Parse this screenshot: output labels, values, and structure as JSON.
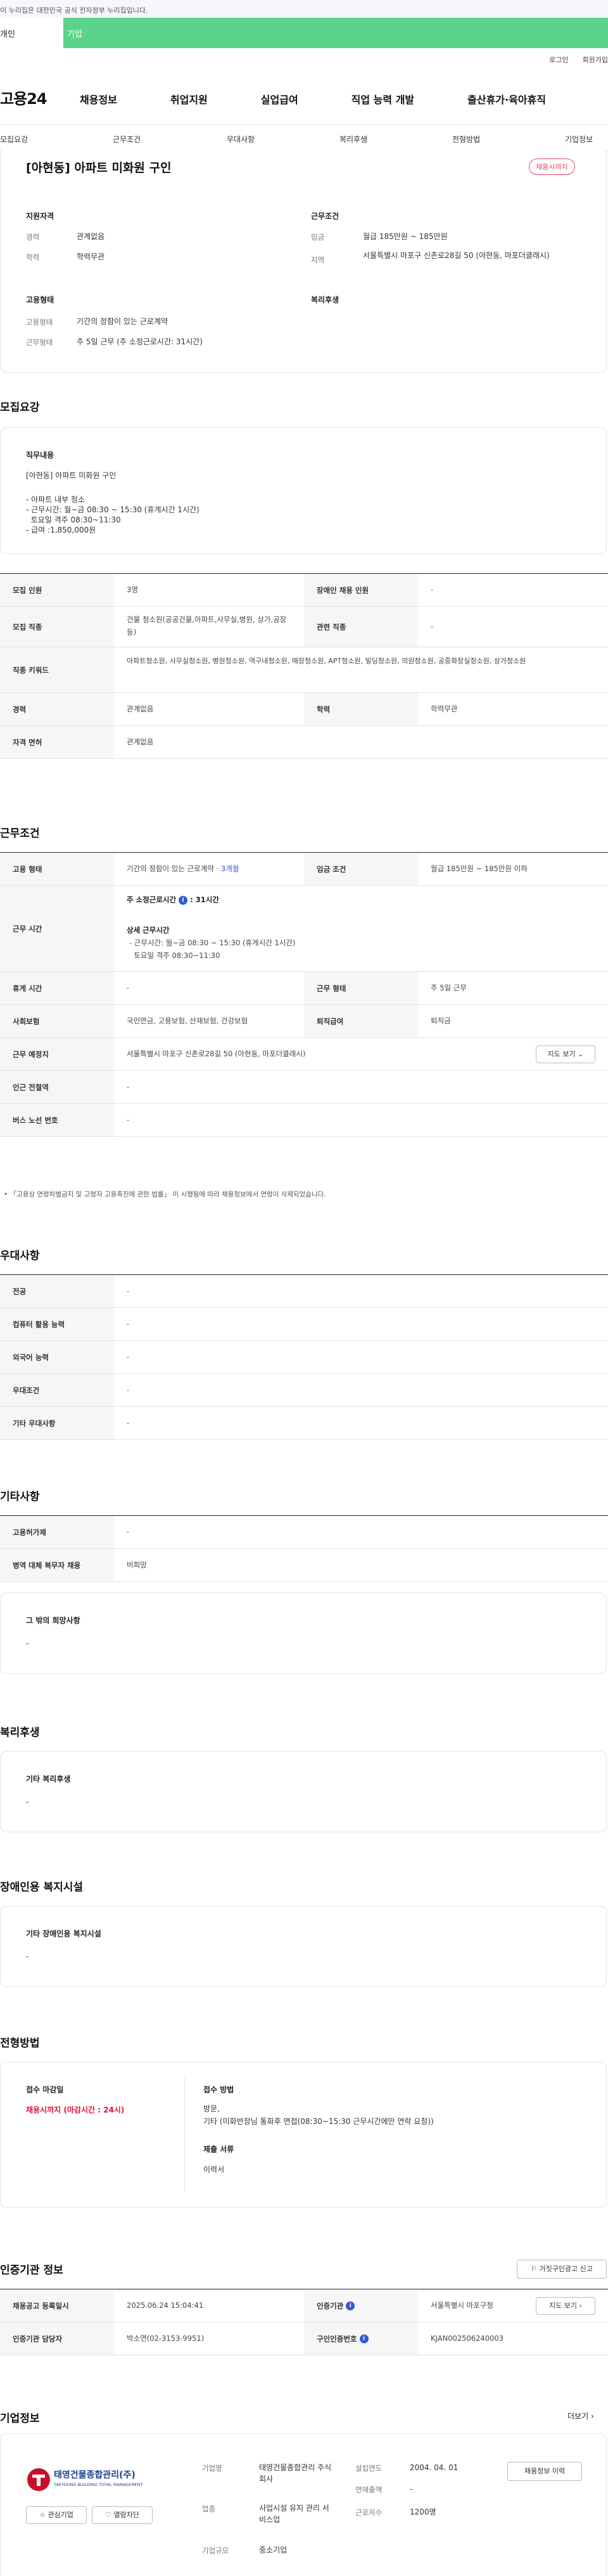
{
  "gov_banner": "이 누리집은 대한민국 공식 전자정부 누리집입니다.",
  "tabs": [
    "개인",
    "기업"
  ],
  "top_links": [
    "로그인",
    "회원가입"
  ],
  "logo": "고용24",
  "gnb": [
    "채용정보",
    "취업지원",
    "실업급여",
    "직업 능력 개발",
    "출산휴가·육아휴직"
  ],
  "subnav": [
    "모집요강",
    "근무조건",
    "우대사항",
    "복리후생",
    "전형방법",
    "기업정보"
  ],
  "summary": {
    "title": "[아현동] 아파트 미화원 구인",
    "badge": "채용시까지",
    "qual_title": "지원자격",
    "career_k": "경력",
    "career_v": "관계없음",
    "edu_k": "학력",
    "edu_v": "학력무관",
    "cond_title": "근무조건",
    "wage_k": "임금",
    "wage_v": "월급 185만원 ~ 185만원",
    "area_k": "지역",
    "area_v": "서울특별시 마포구 신촌로28길 50 (아현동, 마포더클래시)",
    "emp_title": "고용형태",
    "type_k": "고용형태",
    "type_v": "기간의 정함이 있는 근로계약",
    "hours_k": "근무형태",
    "hours_v": "주 5일 근무 (주 소정근로시간: 31시간)",
    "welfare_title": "복리후생"
  },
  "recruit": {
    "section": "모집요강",
    "duty_title": "직무내용",
    "duty_lines": [
      "[아현동] 아파트 미화원 구인",
      "",
      "- 아파트 내부 청소",
      "- 근무시간: 월~금 08:30 ~  15:30 (휴게시간 1시간)",
      "  토요일 격주 08:30~11:30",
      "- 급여 :1,850,000원"
    ],
    "rows": [
      {
        "k1": "모집 인원",
        "v1": "3명",
        "k2": "장애인 채용 인원",
        "v2": "-"
      },
      {
        "k1": "모집 직종",
        "v1": "건물 청소원(공공건물,아파트,사무실,병원, 상가,공장 등)",
        "k2": "관련 직종",
        "v2": "-"
      },
      {
        "k1": "직종 키워드",
        "v1": "아파트청소원, 사무실청소원, 병원청소원, 역구내청소원, 매장청소원, APT청소원, 빌딩청소원, 의원청소원, 공중화장실청소원, 상가청소원"
      },
      {
        "k1": "경력",
        "v1": "관계없음",
        "k2": "학력",
        "v2": "학력무관"
      },
      {
        "k1": "자격 면허",
        "v1": "관계없음"
      }
    ]
  },
  "conditions": {
    "section": "근무조건",
    "emp_k": "고용 형태",
    "emp_v": "기간의 정함이 있는 근로계약 · ",
    "emp_months": "3개월",
    "wage_k": "임금 조건",
    "wage_v": "월급 185만원 ~ 185만원 이하",
    "hours_k": "근무 시간",
    "weekly_label": "주 소정근로시간",
    "weekly_v": "31시간",
    "detail_label": "상세 근무시간",
    "detail_lines": [
      "- 근무시간: 월~금 08:30 ~  15:30 (휴게시간 1시간)",
      "  토요일 격주 08:30~11:30"
    ],
    "rest_k": "휴게 시간",
    "rest_v": "-",
    "form_k": "근무 형태",
    "form_v": "주 5일 근무",
    "ins_k": "사회보험",
    "ins_v": "국민연금, 고용보험, 산재보험, 건강보험",
    "ret_k": "퇴직급여",
    "ret_v": "퇴직금",
    "place_k": "근무 예정지",
    "place_v": "서울특별시 마포구 신촌로28길 50 (아현동, 마포더클래시)",
    "map_btn": "지도 보기",
    "station_k": "인근 전철역",
    "station_v": "-",
    "bus_k": "버스 노선 번호",
    "bus_v": "-",
    "note": "「고용상 연령차별금지 및 고령자 고용촉진에 관한 법률」 이 시행됨에 따라 채용정보에서 연령이 삭제되었습니다."
  },
  "preference": {
    "section": "우대사항",
    "rows": [
      {
        "k": "전공",
        "v": "-"
      },
      {
        "k": "컴퓨터 활용 능력",
        "v": "-"
      },
      {
        "k": "외국어 능력",
        "v": "-"
      },
      {
        "k": "우대조건",
        "v": "-"
      },
      {
        "k": "기타 우대사항",
        "v": "-"
      }
    ]
  },
  "others": {
    "section": "기타사항",
    "rows": [
      {
        "k": "고용허가제",
        "v": "-"
      },
      {
        "k": "병역 대체 복무자 채용",
        "v": "비희망"
      }
    ],
    "wish_title": "그 밖의 희망사항",
    "wish_v": "-"
  },
  "welfare": {
    "section": "복리후생",
    "title": "기타 복리후생",
    "v": "-"
  },
  "disabled": {
    "section": "장애인용 복지시설",
    "title": "기타 장애인용 복지시설",
    "v": "-"
  },
  "selection": {
    "section": "전형방법",
    "deadline_title": "접수 마감일",
    "deadline_v": "채용시까지 (마감시간 : 24시)",
    "method_title": "접수 방법",
    "method_lines": [
      "방문,",
      "기타 (미화반장님 통화후 면접(08:30~15:30 근무시간에만 연락 요청))"
    ],
    "docs_title": "제출 서류",
    "docs_v": "이력서"
  },
  "agency": {
    "section": "인증기관 정보",
    "report_btn": "거짓구인광고 신고",
    "reg_k": "채용공고 등록일시",
    "reg_v": "2025.06.24 15:04:41",
    "org_k": "인증기관",
    "org_v": "서울특별시 마포구청",
    "map_btn": "지도 보기",
    "mgr_k": "인증기관 담당자",
    "mgr_v": "박소연(02-3153-9951)",
    "num_k": "구인인증번호",
    "num_v": "KJAN002506240003"
  },
  "company": {
    "section": "기업정보",
    "more": "더보기",
    "logo_text": "태영건물종합관리(주)",
    "logo_sub": "TAEYOUNG BUILDING TOTAL MANAGEMENT",
    "fav_btn": "관심기업",
    "block_btn": "열람차단",
    "name_k": "기업명",
    "name_v": "태영건물종합관리 주식회사",
    "founded_k": "설립연도",
    "founded_v": "2004. 04. 01",
    "sales_k": "연매출액",
    "sales_v": "-",
    "biz_k": "업종",
    "biz_v": "사업시설 유지 관리 서비스업",
    "emp_k": "근로자수",
    "emp_v": "1200명",
    "size_k": "기업규모",
    "size_v": "중소기업",
    "jobs_btn": "채용정보 이력"
  },
  "colors": {
    "tab_green": "#5cd38a",
    "badge_red": "#e6466a",
    "deadline_red": "#e0143c",
    "link_blue": "#2f5bd8"
  }
}
